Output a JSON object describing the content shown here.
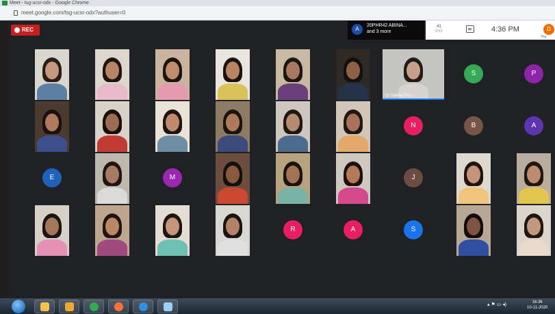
{
  "browser": {
    "window_title": "Meet - tsg-ucsr-odx - Google Chrome",
    "url": "meet.google.com/tsg-ucsr-odx?authuser=0"
  },
  "meet": {
    "rec_label": "REC",
    "join_notice": {
      "avatar_letter": "A",
      "line1": "20PHR42 ABINA...",
      "line2": "and 3 more"
    },
    "participant_count": "41",
    "time": "4:36 PM",
    "self": {
      "avatar_letter": "D",
      "label": "You"
    },
    "participants": [
      {
        "kind": "video",
        "skin": "#c79a7f",
        "hair": "#2b1e18",
        "shirt": "#5d7fa6",
        "bg": "#d9d5cf"
      },
      {
        "kind": "video",
        "skin": "#b88466",
        "hair": "#1e1510",
        "shirt": "#e8b9c8",
        "bg": "#dcd6cc"
      },
      {
        "kind": "video",
        "skin": "#c08c6e",
        "hair": "#1b1410",
        "shirt": "#e49bb0",
        "bg": "#cab39f"
      },
      {
        "kind": "video",
        "skin": "#b98463",
        "hair": "#1a1310",
        "shirt": "#d9c25a",
        "bg": "#e8e4de"
      },
      {
        "kind": "video",
        "skin": "#a87a5d",
        "hair": "#1c1512",
        "shirt": "#6a3f7a",
        "bg": "#c9b9a2"
      },
      {
        "kind": "video",
        "skin": "#8e6147",
        "hair": "#151010",
        "shirt": "#233349",
        "bg": "#2f2a26"
      },
      {
        "kind": "video",
        "skin": "#c7a08a",
        "hair": "#241b16",
        "shirt": "#d7d3d3",
        "bg": "#c5c5c3",
        "name": "Dr Sabha Prin...",
        "active": true
      },
      {
        "kind": "initial",
        "letter": "S",
        "color": "#34a853"
      },
      {
        "kind": "initial",
        "letter": "P",
        "color": "#8e24aa"
      },
      {
        "kind": "video",
        "skin": "#b07b5c",
        "hair": "#1a120e",
        "shirt": "#3d4f8a",
        "bg": "#4a3a30"
      },
      {
        "kind": "video",
        "skin": "#9d6d53",
        "hair": "#160f0c",
        "shirt": "#c23b33",
        "bg": "#d8d2c8"
      },
      {
        "kind": "video",
        "skin": "#c08b6c",
        "hair": "#1d1512",
        "shirt": "#6f8ea3",
        "bg": "#e9e2d6"
      },
      {
        "kind": "video",
        "skin": "#ad7a5c",
        "hair": "#1c1410",
        "shirt": "#3a4a7a",
        "bg": "#8d7b66"
      },
      {
        "kind": "video",
        "skin": "#b88a70",
        "hair": "#1f1713",
        "shirt": "#4d6a8f",
        "bg": "#cdc7bf"
      },
      {
        "kind": "video",
        "skin": "#a8735a",
        "hair": "#211813",
        "shirt": "#e3a96b",
        "bg": "#d1c6b8"
      },
      {
        "kind": "initial",
        "letter": "N",
        "color": "#e91e63"
      },
      {
        "kind": "initial",
        "letter": "B",
        "color": "#795548"
      },
      {
        "kind": "initial",
        "letter": "A",
        "color": "#5e35b1"
      },
      {
        "kind": "initial",
        "letter": "E",
        "color": "#1e63b8"
      },
      {
        "kind": "video",
        "skin": "#a77b63",
        "hair": "#1d1611",
        "shirt": "#dadada",
        "bg": "#bdb7ae"
      },
      {
        "kind": "initial",
        "letter": "M",
        "color": "#9c27b0"
      },
      {
        "kind": "video",
        "skin": "#8a5a3f",
        "hair": "#141010",
        "shirt": "#c9482f",
        "bg": "#6d4d3e"
      },
      {
        "kind": "video",
        "skin": "#a47355",
        "hair": "#1b130f",
        "shirt": "#79b3a6",
        "bg": "#b9a27e"
      },
      {
        "kind": "video",
        "skin": "#b2795b",
        "hair": "#1a120e",
        "shirt": "#d44a8c",
        "bg": "#cfc8c0"
      },
      {
        "kind": "initial",
        "letter": "J",
        "color": "#6d4c41"
      },
      {
        "kind": "video",
        "skin": "#c49478",
        "hair": "#1f1611",
        "shirt": "#f0c47a",
        "bg": "#ddd8d0"
      },
      {
        "kind": "video",
        "skin": "#bd8c6f",
        "hair": "#201712",
        "shirt": "#e2c54e",
        "bg": "#b9ad9d"
      },
      {
        "kind": "video",
        "skin": "#a5765b",
        "hair": "#1c1410",
        "shirt": "#e58fb5",
        "bg": "#d6d0c6"
      },
      {
        "kind": "video",
        "skin": "#b98766",
        "hair": "#1e1511",
        "shirt": "#a04a7f",
        "bg": "#bda68d"
      },
      {
        "kind": "video",
        "skin": "#c6967a",
        "hair": "#1e1511",
        "shirt": "#6cc1b2",
        "bg": "#e4ddd3"
      },
      {
        "kind": "video",
        "skin": "#b28366",
        "hair": "#1a1310",
        "shirt": "#e0e0e0",
        "bg": "#d9d7d2"
      },
      {
        "kind": "initial",
        "letter": "R",
        "color": "#e91e63"
      },
      {
        "kind": "initial",
        "letter": "A",
        "color": "#e91e63"
      },
      {
        "kind": "initial",
        "letter": "S",
        "color": "#1a73e8"
      },
      {
        "kind": "video",
        "skin": "#7f5340",
        "hair": "#120d0b",
        "shirt": "#2f4fa0",
        "bg": "#b9a796"
      },
      {
        "kind": "video",
        "skin": "#c2987f",
        "hair": "#1f1713",
        "shirt": "#e9d8cc",
        "bg": "#dcd5cc"
      }
    ]
  },
  "taskbar": {
    "apps": [
      {
        "name": "explorer",
        "color": "#f2c14e"
      },
      {
        "name": "media-player",
        "color": "#f0a830"
      },
      {
        "name": "chrome",
        "color": "#34a853"
      },
      {
        "name": "firefox",
        "color": "#ff7139"
      },
      {
        "name": "internet-explorer",
        "color": "#2f8fe0"
      },
      {
        "name": "notepad",
        "color": "#9ad0f5"
      }
    ],
    "tray": "▴ ⚑ ▭ ◂)",
    "clock_time": "16:36",
    "clock_date": "10-11-2020"
  }
}
